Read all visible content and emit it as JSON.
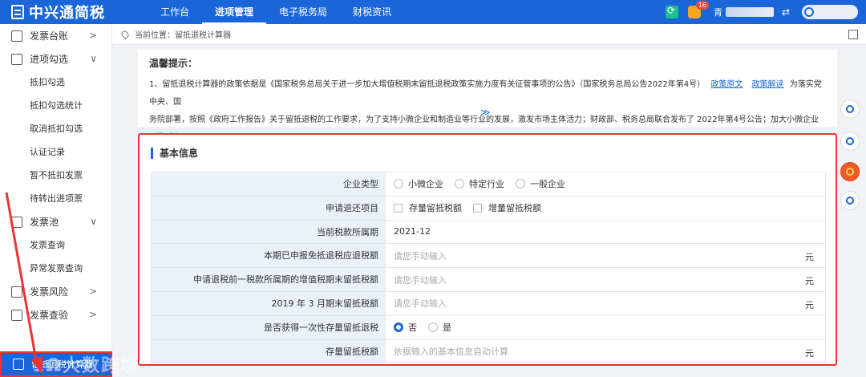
{
  "app": {
    "name": "中兴通简税"
  },
  "nav": [
    "工作台",
    "进项管理",
    "电子税务局",
    "财税资讯"
  ],
  "nav_active": 1,
  "topbar": {
    "bell_badge": "16",
    "user_prefix": "青",
    "swap_icon": "⇄"
  },
  "sidebar": {
    "groups": [
      {
        "label": "发票台账",
        "chev": ">"
      },
      {
        "label": "进项勾选",
        "chev": "∨"
      },
      {
        "label": "发票池",
        "chev": "∨"
      },
      {
        "label": "发票风险",
        "chev": ">"
      },
      {
        "label": "发票查验",
        "chev": ">"
      }
    ],
    "jinxiang_items": [
      "抵扣勾选",
      "抵扣勾选统计",
      "取消抵扣勾选",
      "认证记录",
      "暂不抵扣发票",
      "待转出进项票"
    ],
    "fapiaochi_items": [
      "发票查询",
      "异常发票查询"
    ],
    "active_item": "留抵退税计算器"
  },
  "breadcrumb": {
    "prefix": "当前位置：",
    "current": "留抵退税计算器"
  },
  "notice": {
    "title": "温馨提示：",
    "line1": "1、留抵退税计算器的政策依据是《国家税务总局关于进一步加大增值税期末留抵退税政策实施力度有关征管事项的公告》（国家税务总局公告2022年第4号）",
    "link1": "政策原文",
    "link2": "政策解读",
    "line1_tail": "为落实党中央、国",
    "line2": "务院部署，按照《政府工作报告》关于留抵退税的工作要求，为了支持小微企业和制造业等行业的发展，激发市场主体活力；财政部、税务总局联合发布了 2022年第4号公告；加大小微企业以及“制",
    "more": "≫"
  },
  "panel": {
    "title": "基本信息",
    "rows": [
      {
        "label": "企业类型",
        "options": [
          "小微企业",
          "特定行业",
          "一般企业"
        ]
      },
      {
        "label": "申请退还项目",
        "checks": [
          "存量留抵税额",
          "增量留抵税额"
        ]
      },
      {
        "label": "当前税款所属期",
        "value": "2021-12"
      },
      {
        "label": "本期已申报免抵退税应退税额",
        "placeholder": "请您手动输入",
        "unit": "元"
      },
      {
        "label": "申请退税前一税款所属期的增值税期末留抵税额",
        "placeholder": "请您手动输入",
        "unit": "元"
      },
      {
        "label": "2019 年 3 月期末留抵税额",
        "placeholder": "请您手动输入",
        "unit": "元"
      },
      {
        "label": "是否获得一次性存量留抵退税",
        "yesno": [
          "否",
          "是"
        ],
        "selected": "否"
      },
      {
        "label": "存量留抵税额",
        "placeholder": "依据输入的基本信息自动计算",
        "unit": "元"
      }
    ]
  },
  "watermark": "1Ω大数跨境"
}
